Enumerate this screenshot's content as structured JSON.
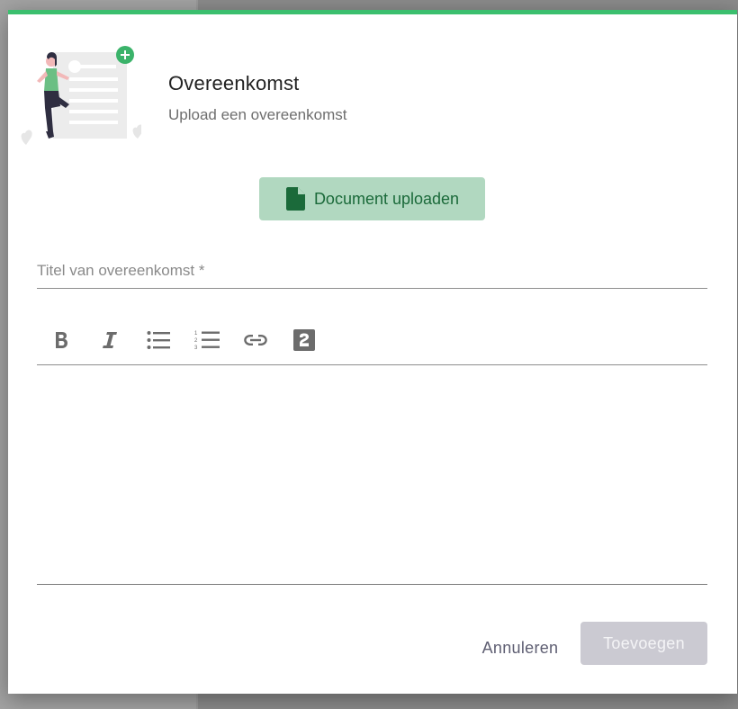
{
  "dialog": {
    "title": "Overeenkomst",
    "subtitle": "Upload een overeenkomst",
    "accent_color": "#3bbf6e"
  },
  "upload": {
    "label": "Document uploaden",
    "icon": "document-icon"
  },
  "form": {
    "title_placeholder": "Titel van overeenkomst *"
  },
  "toolbar": {
    "tools": [
      "bold-icon",
      "italic-icon",
      "bulleted-list-icon",
      "numbered-list-icon",
      "link-icon",
      "heading-icon"
    ]
  },
  "actions": {
    "cancel_label": "Annuleren",
    "add_label": "Toevoegen"
  }
}
